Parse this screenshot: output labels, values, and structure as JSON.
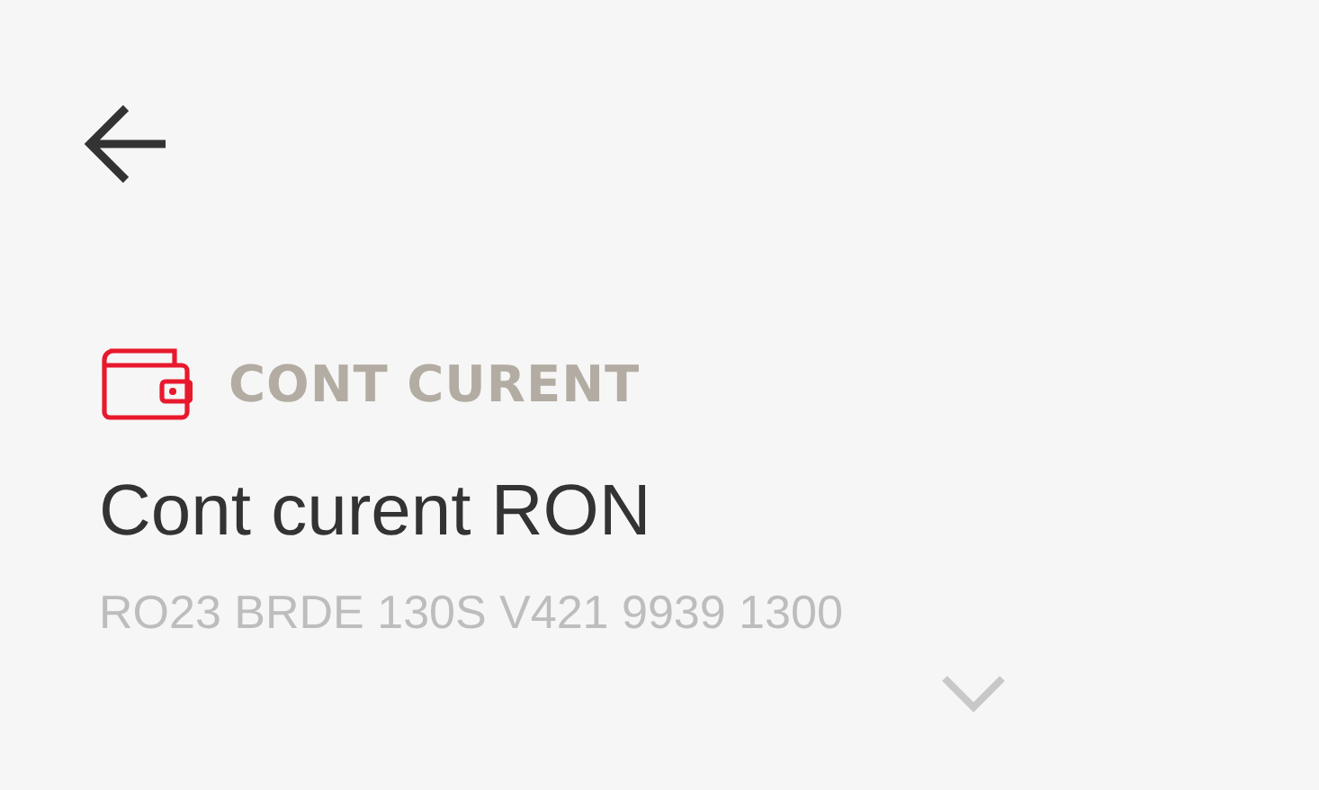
{
  "account": {
    "category": "CONT CURENT",
    "name": "Cont curent RON",
    "iban": "RO23 BRDE 130S V421 9939 1300"
  }
}
